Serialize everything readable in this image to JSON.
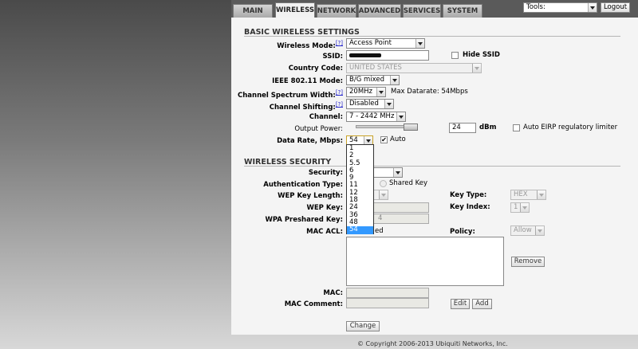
{
  "tabs": [
    "MAIN",
    "WIRELESS",
    "NETWORK",
    "ADVANCED",
    "SERVICES",
    "SYSTEM"
  ],
  "tools": {
    "selected": "Tools:",
    "logout": "Logout"
  },
  "basic": {
    "title": "BASIC WIRELESS SETTINGS",
    "help": "[?]",
    "wireless_mode_label": "Wireless Mode:",
    "wireless_mode": "Access Point",
    "ssid_label": "SSID:",
    "ssid_value": "",
    "hide_ssid": "Hide SSID",
    "country_label": "Country Code:",
    "country": "UNITED STATES",
    "ieee_label": "IEEE 802.11 Mode:",
    "ieee": "B/G mixed",
    "spectrum_label": "Channel Spectrum Width:",
    "spectrum": "20MHz",
    "max_datarate": "Max Datarate: 54Mbps",
    "shifting_label": "Channel Shifting:",
    "shifting": "Disabled",
    "channel_label": "Channel:",
    "channel": "7 - 2442 MHz",
    "power_label": "Output Power:",
    "power_value": "24",
    "power_unit": "dBm",
    "eirp_label": "Auto EIRP regulatory limiter",
    "datarate_label": "Data Rate, Mbps:",
    "datarate": "54",
    "auto_label": "Auto",
    "datarate_options": [
      "1",
      "2",
      "5.5",
      "6",
      "9",
      "11",
      "12",
      "18",
      "24",
      "36",
      "48",
      "54"
    ]
  },
  "security": {
    "title": "WIRELESS SECURITY",
    "security_label": "Security:",
    "auth_label": "Authentication Type:",
    "shared_key": "Shared Key",
    "wep_len_label": "WEP Key Length:",
    "key_type_label": "Key Type:",
    "key_type": "HEX",
    "wep_key_label": "WEP Key:",
    "key_index_label": "Key Index:",
    "key_index": "1",
    "wpa_label": "WPA Preshared Key:",
    "wpa_partial": "4",
    "mac_acl_label": "MAC ACL:",
    "mac_acl_partial": "ed",
    "policy_label": "Policy:",
    "policy": "Allow",
    "remove": "Remove",
    "mac_label": "MAC:",
    "mac_comment_label": "MAC Comment:",
    "edit": "Edit",
    "add": "Add"
  },
  "change": "Change",
  "copyright": "© Copyright 2006-2013 Ubiquiti Networks, Inc."
}
